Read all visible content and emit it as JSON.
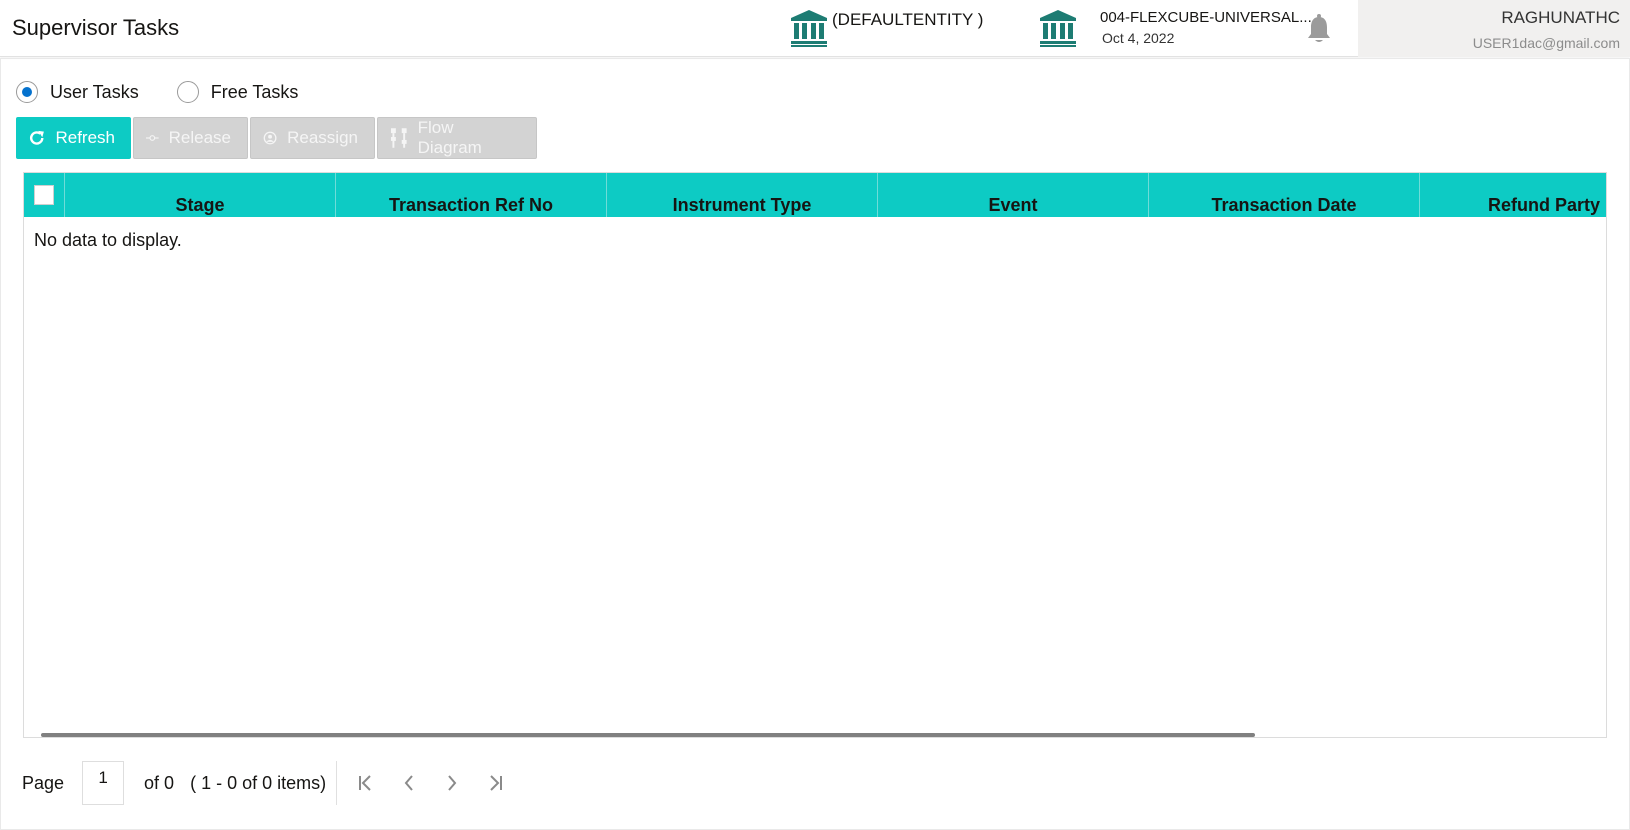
{
  "header": {
    "title": "Supervisor Tasks",
    "entity": "(DEFAULTENTITY )",
    "branch": "004-FLEXCUBE-UNIVERSAL...",
    "date": "Oct 4, 2022",
    "user_name": "RAGHUNATHC",
    "user_email": "USER1dac@gmail.com",
    "icon_color": "#1d7c73"
  },
  "task_filter": {
    "options": [
      {
        "label": "User Tasks",
        "checked": true
      },
      {
        "label": "Free Tasks",
        "checked": false
      }
    ]
  },
  "toolbar": {
    "refresh_label": "Refresh",
    "release_label": "Release",
    "reassign_label": "Reassign",
    "flow_diagram_label": "Flow Diagram",
    "accent_color": "#0dcbc4"
  },
  "grid": {
    "columns": [
      "Stage",
      "Transaction Ref No",
      "Instrument Type",
      "Event",
      "Transaction Date",
      "Refund Party"
    ],
    "empty_message": "No data to display."
  },
  "pagination": {
    "page_label": "Page",
    "current_page": "1",
    "of_label": "of 0",
    "items_summary": "( 1 - 0 of 0 items)"
  }
}
